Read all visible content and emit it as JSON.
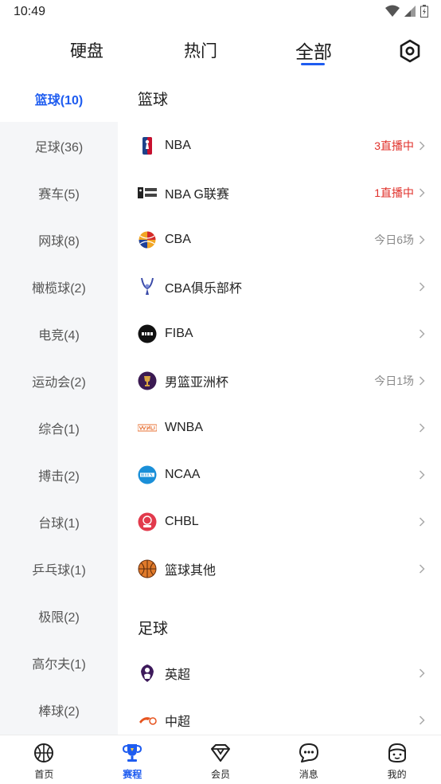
{
  "status_bar": {
    "time": "10:49"
  },
  "top_tabs": [
    {
      "label": "硬盘"
    },
    {
      "label": "热门"
    },
    {
      "label": "全部"
    }
  ],
  "sidebar": {
    "items": [
      {
        "label": "篮球(10)"
      },
      {
        "label": "足球(36)"
      },
      {
        "label": "赛车(5)"
      },
      {
        "label": "网球(8)"
      },
      {
        "label": "橄榄球(2)"
      },
      {
        "label": "电竞(4)"
      },
      {
        "label": "运动会(2)"
      },
      {
        "label": "综合(1)"
      },
      {
        "label": "搏击(2)"
      },
      {
        "label": "台球(1)"
      },
      {
        "label": "乒乓球(1)"
      },
      {
        "label": "极限(2)"
      },
      {
        "label": "高尔夫(1)"
      },
      {
        "label": "棒球(2)"
      }
    ]
  },
  "main": {
    "sections": [
      {
        "title": "篮球",
        "rows": [
          {
            "name": "NBA",
            "status": "3直播中",
            "status_type": "live",
            "icon": "nba-logo-icon"
          },
          {
            "name": "NBA G联赛",
            "status": "1直播中",
            "status_type": "live",
            "icon": "nba-g-league-logo-icon"
          },
          {
            "name": "CBA",
            "status": "今日6场",
            "status_type": "today",
            "icon": "cba-logo-icon"
          },
          {
            "name": "CBA俱乐部杯",
            "status": "",
            "status_type": "",
            "icon": "cba-club-cup-logo-icon"
          },
          {
            "name": "FIBA",
            "status": "",
            "status_type": "",
            "icon": "fiba-logo-icon"
          },
          {
            "name": "男篮亚洲杯",
            "status": "今日1场",
            "status_type": "today",
            "icon": "asia-cup-logo-icon"
          },
          {
            "name": "WNBA",
            "status": "",
            "status_type": "",
            "icon": "wnba-logo-icon"
          },
          {
            "name": "NCAA",
            "status": "",
            "status_type": "",
            "icon": "ncaa-logo-icon"
          },
          {
            "name": "CHBL",
            "status": "",
            "status_type": "",
            "icon": "chbl-logo-icon"
          },
          {
            "name": "篮球其他",
            "status": "",
            "status_type": "",
            "icon": "basketball-icon"
          }
        ]
      },
      {
        "title": "足球",
        "rows": [
          {
            "name": "英超",
            "status": "",
            "status_type": "",
            "icon": "premier-league-logo-icon"
          },
          {
            "name": "中超",
            "status": "",
            "status_type": "",
            "icon": "csl-logo-icon"
          }
        ]
      }
    ]
  },
  "bottom_nav": [
    {
      "label": "首页",
      "icon": "basketball-icon"
    },
    {
      "label": "赛程",
      "icon": "trophy-icon"
    },
    {
      "label": "会员",
      "icon": "diamond-icon"
    },
    {
      "label": "消息",
      "icon": "chat-bubble-icon"
    },
    {
      "label": "我的",
      "icon": "profile-face-icon"
    }
  ],
  "colors": {
    "accent": "#1e5cf0",
    "live": "#e0312b",
    "muted": "#8a8a8a",
    "sidebar_bg": "#f5f6f8"
  }
}
